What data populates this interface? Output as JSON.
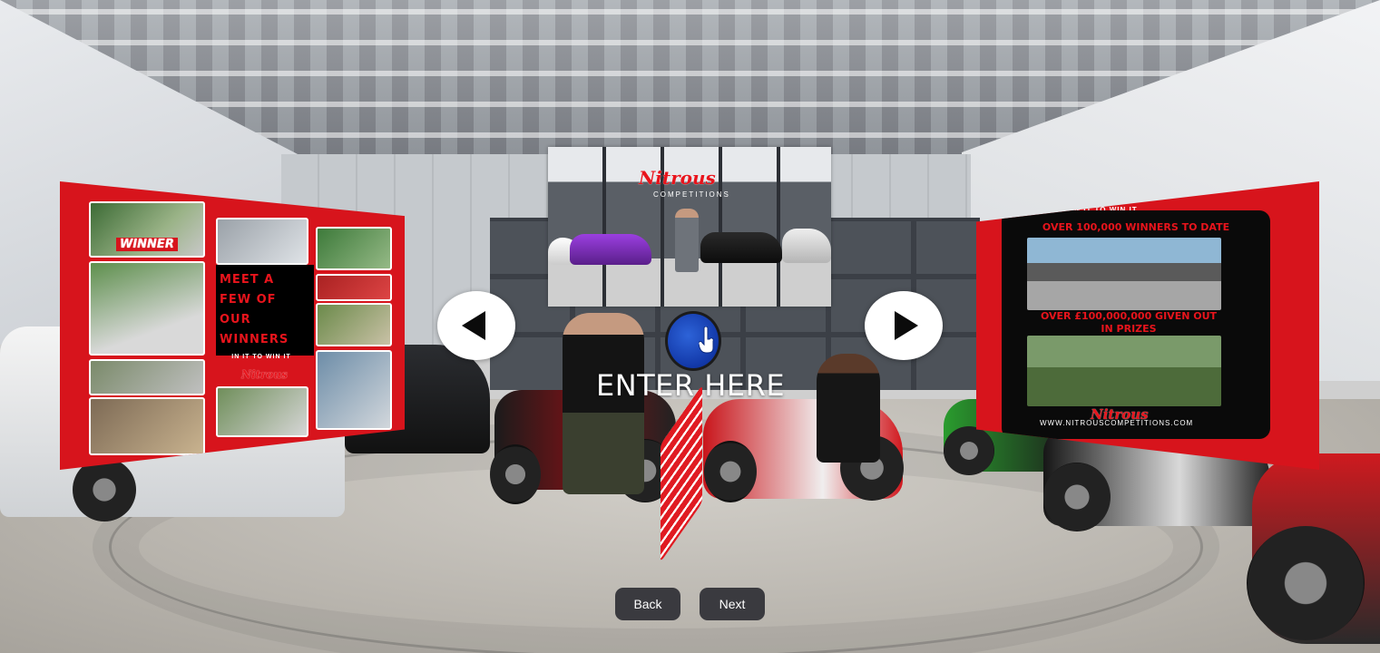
{
  "left_panel": {
    "heading": "MEET A FEW OF OUR WINNERS",
    "tagline": "IN IT TO WIN IT",
    "photo_caption": "WINNER",
    "logo_text": "Nitrous"
  },
  "center_video": {
    "logo_text": "Nitrous",
    "logo_subtitle": "COMPETITIONS"
  },
  "right_panel": {
    "tagline": "IN IT TO WIN IT",
    "headline_1": "OVER 100,000 WINNERS TO DATE",
    "headline_2": "OVER £100,000,000 GIVEN OUT IN PRIZES",
    "logo_text": "Nitrous",
    "url": "WWW.NITROUSCOMPETITIONS.COM"
  },
  "hotspot": {
    "label": "ENTER HERE",
    "icon": "hand-pointer-icon"
  },
  "nav": {
    "prev_icon": "chevron-left-icon",
    "next_icon": "chevron-right-icon"
  },
  "buttons": {
    "back_label": "Back",
    "next_label": "Next",
    "color": "#3a3a3f"
  },
  "colors": {
    "brand_red": "#d7141c",
    "hotspot_blue": "#1f4fc4"
  }
}
